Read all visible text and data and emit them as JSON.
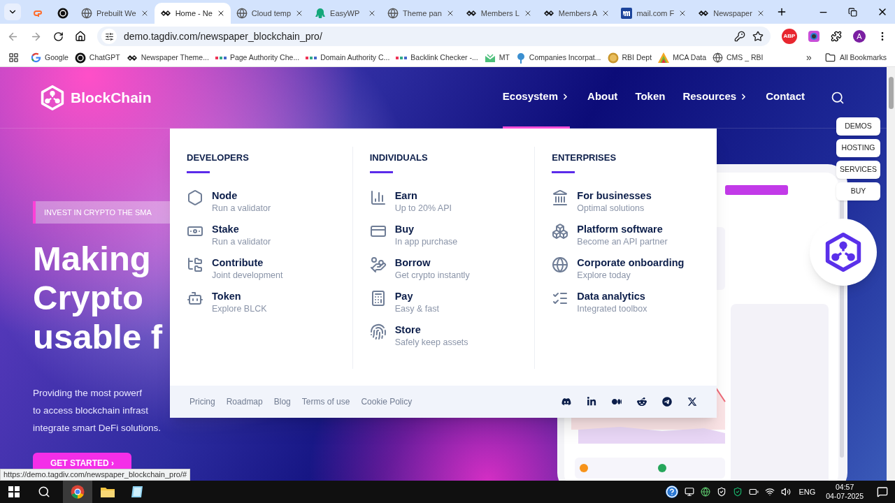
{
  "browser": {
    "tabs": [
      {
        "selected": false
      },
      {
        "selected": false
      },
      {
        "label": "Prebuilt We",
        "selected": false
      },
      {
        "label": "Home - Ne",
        "selected": true
      },
      {
        "label": "Cloud temp",
        "selected": false
      },
      {
        "label": "EasyWP",
        "selected": false
      },
      {
        "label": "Theme pan",
        "selected": false
      },
      {
        "label": "Members L",
        "selected": false
      },
      {
        "label": "Members A",
        "selected": false
      },
      {
        "label": "mail.com F",
        "selected": false
      },
      {
        "label": "Newspaper",
        "selected": false
      }
    ],
    "address": "demo.tagdiv.com/newspaper_blockchain_pro/",
    "extension_badge": "ABP",
    "profile_initial": "A",
    "bookmarks": [
      "Google",
      "ChatGPT",
      "Newspaper Theme...",
      "Page Authority Che...",
      "Domain Authority C...",
      "Backlink Checker -...",
      "MT",
      "Companies Incorpat...",
      "RBI Dept",
      "MCA Data",
      "CMS _ RBI"
    ],
    "bookmarks_overflow": "»",
    "all_bookmarks": "All Bookmarks"
  },
  "page": {
    "logo": "BlockChain",
    "nav": [
      {
        "label": "Ecosystem",
        "submenu": true,
        "selected": true
      },
      {
        "label": "About",
        "submenu": false,
        "selected": false
      },
      {
        "label": "Token",
        "submenu": false,
        "selected": false
      },
      {
        "label": "Resources",
        "submenu": true,
        "selected": false
      },
      {
        "label": "Contact",
        "submenu": false,
        "selected": false
      }
    ],
    "hero": {
      "tagline": "INVEST IN CRYPTO THE SMA",
      "heading": [
        "Making",
        "Crypto",
        "usable f"
      ],
      "paragraph": [
        "Providing the most powerf",
        "to access blockchain infrast",
        "integrate smart DeFi solutions."
      ],
      "cta": "GET STARTED ›"
    },
    "side_buttons": [
      "DEMOS",
      "HOSTING",
      "SERVICES",
      "BUY"
    ],
    "mega_menu": {
      "columns": [
        {
          "heading": "DEVELOPERS",
          "items": [
            {
              "title": "Node",
              "subtitle": "Run a validator"
            },
            {
              "title": "Stake",
              "subtitle": "Run a validator"
            },
            {
              "title": "Contribute",
              "subtitle": "Joint development"
            },
            {
              "title": "Token",
              "subtitle": "Explore BLCK"
            }
          ]
        },
        {
          "heading": "INDIVIDUALS",
          "items": [
            {
              "title": "Earn",
              "subtitle": "Up to 20% API"
            },
            {
              "title": "Buy",
              "subtitle": "In app purchase"
            },
            {
              "title": "Borrow",
              "subtitle": "Get crypto instantly"
            },
            {
              "title": "Pay",
              "subtitle": "Easy & fast"
            },
            {
              "title": "Store",
              "subtitle": "Safely keep assets"
            }
          ]
        },
        {
          "heading": "ENTERPRISES",
          "items": [
            {
              "title": "For businesses",
              "subtitle": "Optimal solutions"
            },
            {
              "title": "Platform software",
              "subtitle": "Become an API partner"
            },
            {
              "title": "Corporate onboarding",
              "subtitle": "Explore today"
            },
            {
              "title": "Data analytics",
              "subtitle": "Integrated toolbox"
            }
          ]
        }
      ],
      "footer_links": [
        "Pricing",
        "Roadmap",
        "Blog",
        "Terms of use",
        "Cookie Policy"
      ]
    }
  },
  "status_url": "https://demo.tagdiv.com/newspaper_blockchain_pro/#",
  "taskbar": {
    "language": "ENG",
    "time": "04:57",
    "date": "04-07-2025"
  }
}
